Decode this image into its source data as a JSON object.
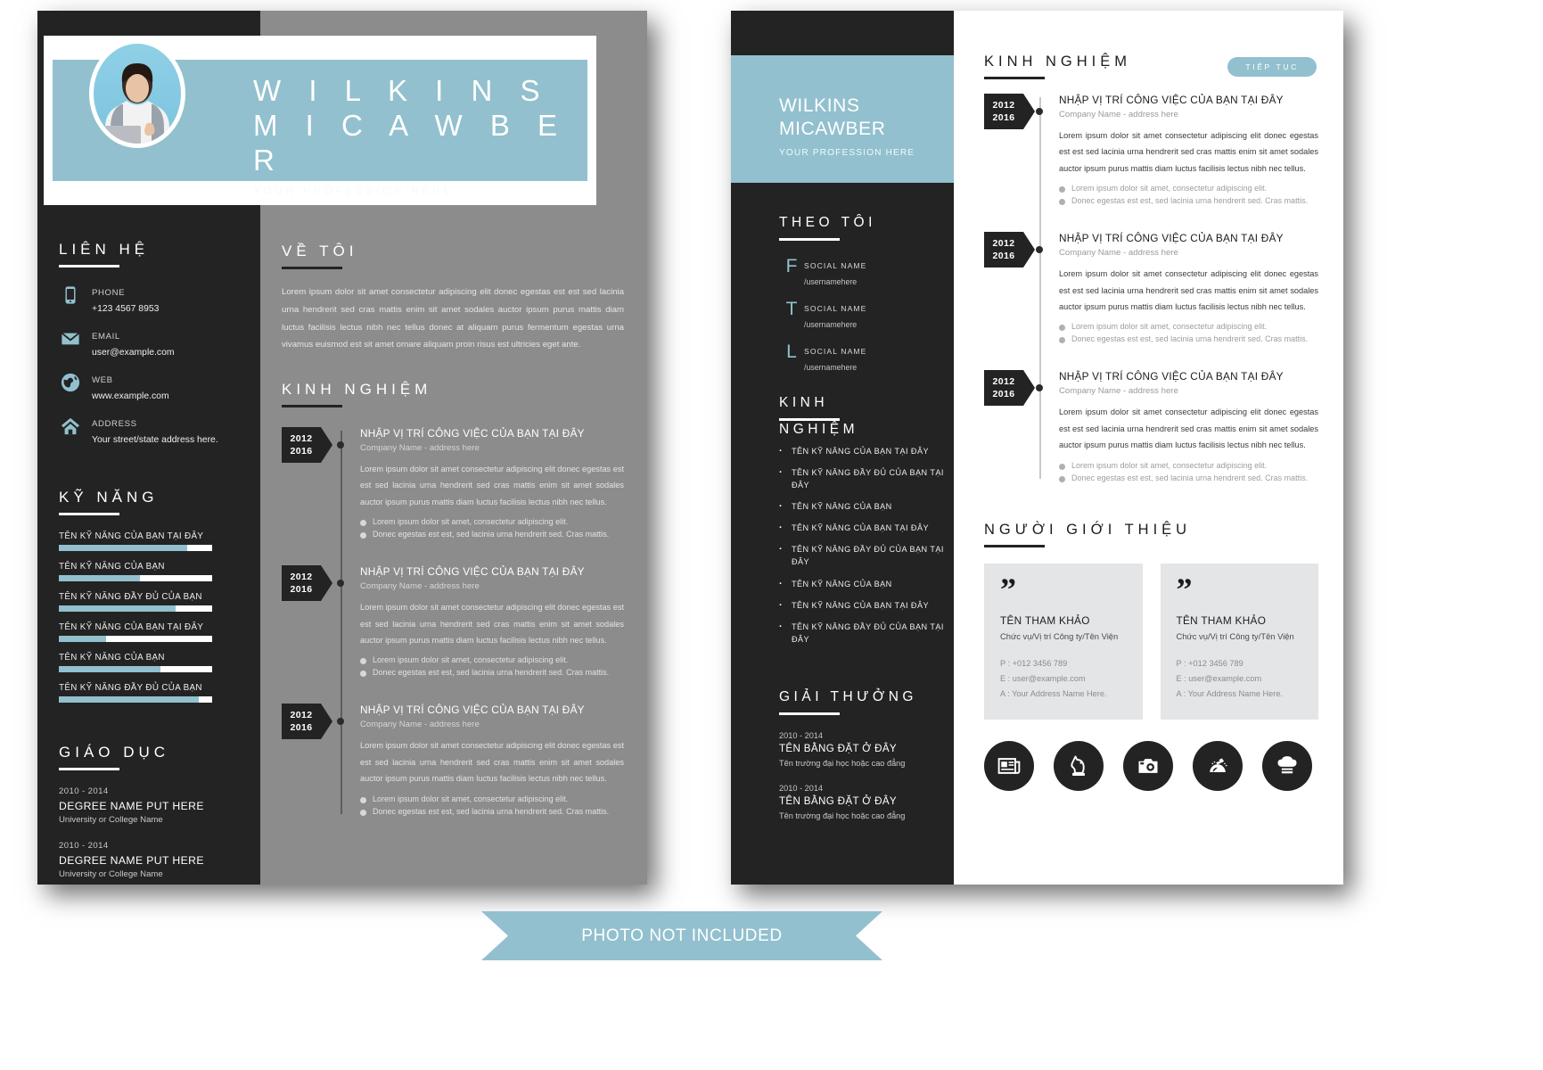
{
  "brand": {
    "accent": "#92c0ce",
    "dark": "#232323",
    "gray": "#8c8c8c",
    "light_gray": "#e4e5e6"
  },
  "person": {
    "first_name": "W I L K I N S",
    "last_name": "M I C A W B E R",
    "first_name_plain": "WILKINS",
    "last_name_plain": "MICAWBER",
    "profession": "YOUR PROFESSION HERE",
    "profession_p2": "YOUR PROFESSION HERE"
  },
  "page1": {
    "contact": {
      "heading": "LIÊN HỆ",
      "items": [
        {
          "icon": "phone-icon",
          "label": "PHONE",
          "value": "+123 4567 8953"
        },
        {
          "icon": "email-icon",
          "label": "EMAIL",
          "value": "user@example.com"
        },
        {
          "icon": "globe-icon",
          "label": "WEB",
          "value": "www.example.com"
        },
        {
          "icon": "home-icon",
          "label": "ADDRESS",
          "value": "Your street/state address here."
        }
      ]
    },
    "skills": {
      "heading": "KỸ NĂNG",
      "items": [
        {
          "name": "TÊN KỸ NĂNG CỦA BẠN TẠI ĐÂY",
          "percent": 84
        },
        {
          "name": "TÊN KỸ NĂNG CỦA BẠN",
          "percent": 53
        },
        {
          "name": "TÊN KỸ NĂNG ĐẦY ĐỦ CỦA BẠN",
          "percent": 76
        },
        {
          "name": "TÊN KỸ NĂNG CỦA BẠN TẠI ĐÂY",
          "percent": 31
        },
        {
          "name": "TÊN KỸ NĂNG CỦA BẠN",
          "percent": 66
        },
        {
          "name": "TÊN KỸ NĂNG ĐẦY ĐỦ CỦA BẠN",
          "percent": 91
        }
      ]
    },
    "education": {
      "heading": "GIÁO DỤC",
      "items": [
        {
          "years": "2010 - 2014",
          "degree": "DEGREE NAME PUT HERE",
          "school": "University or College Name"
        },
        {
          "years": "2010 - 2014",
          "degree": "DEGREE NAME PUT HERE",
          "school": "University or College Name"
        }
      ]
    },
    "about": {
      "heading": "VỀ TÔI",
      "body": "Lorem ipsum dolor sit amet consectetur adipiscing elit donec egestas est est sed lacinia urna hendrerit sed cras mattis enim sit amet sodales auctor ipsum purus mattis diam luctus facilisis lectus nibh nec tellus donec at aliquam purus fermentum egestas urna vivamus euismod est sit amet ornare aliquam proin risus est ultricies eget ante."
    },
    "experience": {
      "heading": "KINH NGHIỆM",
      "items": [
        {
          "year_from": "2012",
          "year_to": "2016",
          "title": "NHẬP VỊ TRÍ CÔNG VIỆC CỦA BẠN TẠI ĐÂY",
          "company": "Company Name - address here",
          "desc": "Lorem ipsum dolor sit amet consectetur adipiscing elit donec egestas est est sed lacinia urna hendrerit sed cras mattis enim sit amet sodales auctor ipsum purus mattis diam luctus facilisis lectus nibh nec tellus.",
          "bullets": [
            "Lorem ipsum dolor sit amet, consectetur adipiscing elit.",
            "Donec egestas est est, sed lacinia urna hendrerit sed. Cras mattis."
          ]
        },
        {
          "year_from": "2012",
          "year_to": "2016",
          "title": "NHẬP VỊ TRÍ CÔNG VIỆC CỦA BẠN TẠI ĐÂY",
          "company": "Company Name - address here",
          "desc": "Lorem ipsum dolor sit amet consectetur adipiscing elit donec egestas est est sed lacinia urna hendrerit sed cras mattis enim sit amet sodales auctor ipsum purus mattis diam luctus facilisis lectus nibh nec tellus.",
          "bullets": [
            "Lorem ipsum dolor sit amet, consectetur adipiscing elit.",
            "Donec egestas est est, sed lacinia urna hendrerit sed. Cras mattis."
          ]
        },
        {
          "year_from": "2012",
          "year_to": "2016",
          "title": "NHẬP VỊ TRÍ CÔNG VIỆC CỦA BẠN TẠI ĐÂY",
          "company": "Company Name - address here",
          "desc": "Lorem ipsum dolor sit amet consectetur adipiscing elit donec egestas est est sed lacinia urna hendrerit sed cras mattis enim sit amet sodales auctor ipsum purus mattis diam luctus facilisis lectus nibh nec tellus.",
          "bullets": [
            "Lorem ipsum dolor sit amet, consectetur adipiscing elit.",
            "Donec egestas est est, sed lacinia urna hendrerit sed. Cras mattis."
          ]
        }
      ]
    }
  },
  "page2": {
    "social": {
      "heading": "THEO TÔI",
      "items": [
        {
          "icon": "facebook-letter-icon",
          "glyph": "F",
          "name": "SOCIAL   NAME",
          "username": "/usernamehere"
        },
        {
          "icon": "twitter-letter-icon",
          "glyph": "T",
          "name": "SOCIAL NAME",
          "username": "/usernamehere"
        },
        {
          "icon": "linkedin-letter-icon",
          "glyph": "L",
          "name": "SOCIAL NAME",
          "username": "/usernamehere"
        }
      ]
    },
    "skills": {
      "heading_line1": "KINH",
      "heading_line2": "NGHIỆM",
      "items": [
        "TÊN KỸ NĂNG CỦA BẠN TẠI ĐÂY",
        "TÊN KỸ NĂNG ĐẦY ĐỦ CỦA BẠN TẠI ĐÂY",
        "TÊN KỸ NĂNG CỦA BẠN",
        "TÊN KỸ NĂNG CỦA BẠN TẠI ĐÂY",
        "TÊN KỸ NĂNG ĐẦY ĐỦ CỦA BẠN TẠI ĐÂY",
        "TÊN KỸ NĂNG CỦA BẠN",
        "TÊN KỸ NĂNG CỦA BẠN TẠI ĐÂY",
        "TÊN KỸ NĂNG ĐẦY ĐỦ CỦA BẠN TẠI ĐÂY"
      ]
    },
    "awards": {
      "heading": "GIẢI THƯỞNG",
      "items": [
        {
          "years": "2010 - 2014",
          "title": "TÊN BẰNG ĐẶT Ở ĐÂY",
          "school": "Tên trường đại học hoặc cao đẳng"
        },
        {
          "years": "2010 - 2014",
          "title": "TÊN BẰNG ĐẶT Ở ĐÂY",
          "school": "Tên trường đại học hoặc cao đẳng"
        }
      ]
    },
    "experience": {
      "heading": "KINH NGHIỆM",
      "pill_label": "TIẾP TỤC",
      "items": [
        {
          "year_from": "2012",
          "year_to": "2016",
          "title": "NHẬP VỊ TRÍ CÔNG VIỆC CỦA BẠN TẠI ĐÂY",
          "company": "Company Name - address here",
          "desc": "Lorem ipsum dolor sit amet consectetur adipiscing elit donec egestas est est sed lacinia urna hendrerit sed cras mattis enim sit amet sodales auctor ipsum purus mattis diam luctus facilisis lectus nibh nec tellus.",
          "bullets": [
            "Lorem ipsum dolor sit amet, consectetur adipiscing elit.",
            "Donec egestas est est, sed lacinia urna hendrerit sed. Cras mattis."
          ]
        },
        {
          "year_from": "2012",
          "year_to": "2016",
          "title": "NHẬP VỊ TRÍ CÔNG VIỆC CỦA BẠN TẠI ĐÂY",
          "company": "Company Name - address here",
          "desc": "Lorem ipsum dolor sit amet consectetur adipiscing elit donec egestas est est sed lacinia urna hendrerit sed cras mattis enim sit amet sodales auctor ipsum purus mattis diam luctus facilisis lectus nibh nec tellus.",
          "bullets": [
            "Lorem ipsum dolor sit amet, consectetur adipiscing elit.",
            "Donec egestas est est, sed lacinia urna hendrerit sed. Cras mattis."
          ]
        },
        {
          "year_from": "2012",
          "year_to": "2016",
          "title": "NHẬP VỊ TRÍ CÔNG VIỆC CỦA BẠN TẠI ĐÂY",
          "company": "Company Name - address here",
          "desc": "Lorem ipsum dolor sit amet consectetur adipiscing elit donec egestas est est sed lacinia urna hendrerit sed cras mattis enim sit amet sodales auctor ipsum purus mattis diam luctus facilisis lectus nibh nec tellus.",
          "bullets": [
            "Lorem ipsum dolor sit amet, consectetur adipiscing elit.",
            "Donec egestas est est, sed lacinia urna hendrerit sed. Cras mattis."
          ]
        }
      ]
    },
    "references": {
      "heading": "NGƯỜI GIỚI THIỆU",
      "quote_glyph": "”",
      "items": [
        {
          "name": "TÊN THAM KHẢO",
          "role": "Chức vụ/Vị trí Công ty/Tên Viện",
          "phone": "P : +012 3456 789",
          "email": "E : user@example.com",
          "address": "A : Your Address Name Here."
        },
        {
          "name": "TÊN THAM KHẢO",
          "role": "Chức vụ/Vị trí Công ty/Tên Viện",
          "phone": "P : +012 3456 789",
          "email": "E : user@example.com",
          "address": "A : Your Address Name Here."
        }
      ]
    },
    "hobby_icons": [
      "newspaper-icon",
      "chess-knight-icon",
      "camera-icon",
      "travel-airplane-icon",
      "chef-hat-icon"
    ]
  },
  "ribbon": {
    "label": "PHOTO NOT INCLUDED"
  }
}
